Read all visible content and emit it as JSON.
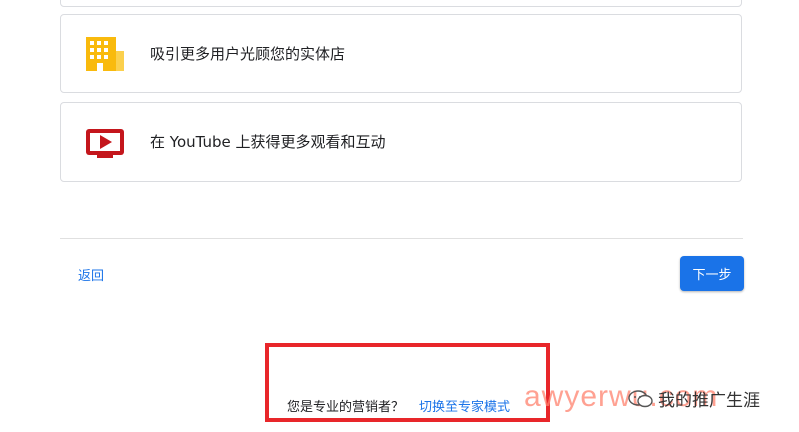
{
  "options": [
    {
      "label": "吸引更多用户光顾您的实体店",
      "icon": "storefront-icon",
      "icon_color": "#f9ba0d"
    },
    {
      "label": "在 YouTube 上获得更多观看和互动",
      "icon": "youtube-play-icon",
      "icon_color": "#c4161c"
    }
  ],
  "nav": {
    "back_label": "返回",
    "next_label": "下一步"
  },
  "footer": {
    "question": "您是专业的营销者？",
    "expert_link": "切换至专家模式"
  },
  "watermark": {
    "site": "awyerwu.com",
    "account": "我的推广生涯"
  },
  "colors": {
    "primary": "#1a73e8",
    "highlight": "#e8262a",
    "border": "#dadce0"
  }
}
